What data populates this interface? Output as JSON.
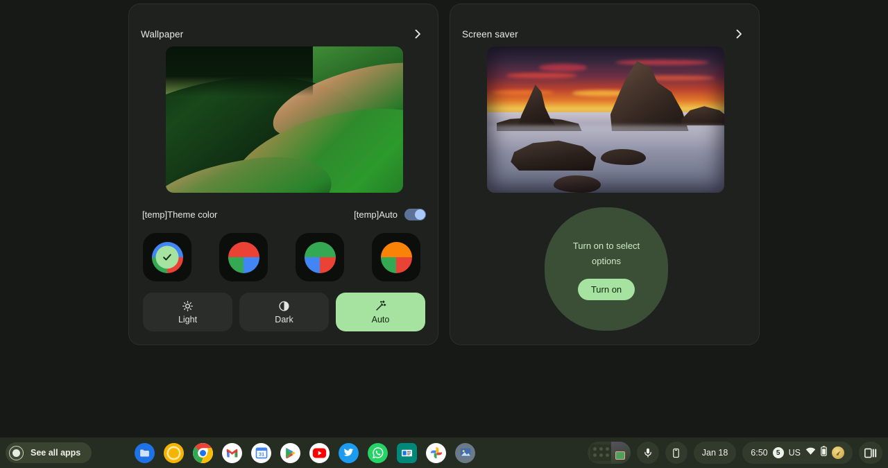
{
  "wallpaper_card": {
    "title": "Wallpaper",
    "chevron_icon": "chevron-right-icon",
    "preview_alt": "abstract-green-wave-wallpaper",
    "theme_color_label": "[temp]Theme color",
    "auto_label": "[temp]Auto",
    "auto_toggle_on": true,
    "swatches": [
      {
        "name": "blue-green-red",
        "top": "#4285f4",
        "bottom_left": "#34a853",
        "bottom_right": "#ea4335",
        "selected": true
      },
      {
        "name": "red-green-blue",
        "top": "#ea4335",
        "bottom_left": "#34a853",
        "bottom_right": "#4285f4",
        "selected": false
      },
      {
        "name": "green-blue-red",
        "top": "#34a853",
        "bottom_left": "#4285f4",
        "bottom_right": "#ea4335",
        "selected": false
      },
      {
        "name": "orange-green-red",
        "top": "#f98207",
        "bottom_left": "#34a853",
        "bottom_right": "#ea4335",
        "selected": false
      }
    ],
    "modes": [
      {
        "label": "Light",
        "icon": "sun-icon",
        "selected": false
      },
      {
        "label": "Dark",
        "icon": "contrast-icon",
        "selected": false
      },
      {
        "label": "Auto",
        "icon": "magic-wand-icon",
        "selected": true
      }
    ]
  },
  "screensaver_card": {
    "title": "Screen saver",
    "chevron_icon": "chevron-right-icon",
    "preview_alt": "sunset-sea-stacks-photo",
    "badge_text": "Turn on to select options",
    "turn_on_label": "Turn on"
  },
  "shelf": {
    "launcher_label": "See all apps",
    "launcher_icon": "launcher-circle-icon",
    "apps": [
      {
        "name": "files",
        "label": "Files"
      },
      {
        "name": "chrome-canary",
        "label": "Chrome Canary"
      },
      {
        "name": "chrome",
        "label": "Chrome"
      },
      {
        "name": "gmail",
        "label": "Gmail"
      },
      {
        "name": "calendar",
        "label": "Calendar",
        "day": "31"
      },
      {
        "name": "play-store",
        "label": "Play Store"
      },
      {
        "name": "youtube",
        "label": "YouTube"
      },
      {
        "name": "twitter",
        "label": "Twitter"
      },
      {
        "name": "whatsapp",
        "label": "WhatsApp"
      },
      {
        "name": "google-news",
        "label": "Google News"
      },
      {
        "name": "google-photos",
        "label": "Google Photos"
      },
      {
        "name": "gallery",
        "label": "Gallery"
      }
    ],
    "status": {
      "date": "Jan 18",
      "time": "6:50",
      "notification_count": "5",
      "keyboard_layout": "US",
      "wifi_icon": "wifi-icon",
      "battery_icon": "battery-icon",
      "avatar_icon": "avatar-icon",
      "split_view_icon": "split-view-icon",
      "desk_preview_icon": "desk-preview-icon",
      "dictation_icon": "microphone-icon",
      "phone_hub_icon": "phone-icon"
    }
  },
  "colors": {
    "page_bg": "#161916",
    "card_bg": "#1e211e",
    "accent_green": "#a6e3a1",
    "toggle_on": "#a8c7fa",
    "shelf_bg": "#252c22"
  }
}
